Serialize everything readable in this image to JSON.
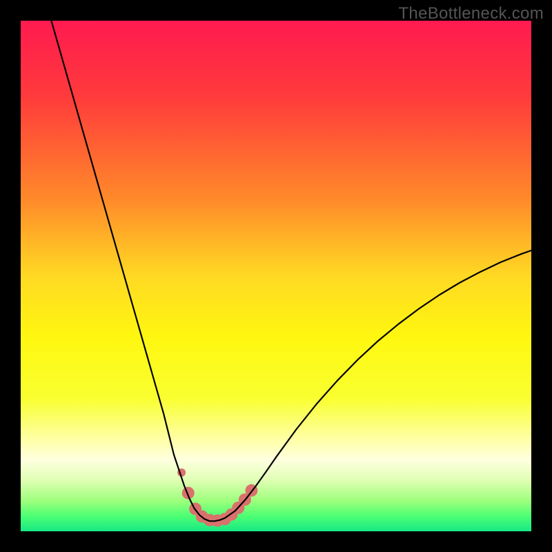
{
  "watermark": "TheBottleneck.com",
  "chart_data": {
    "type": "line",
    "title": "",
    "xlabel": "",
    "ylabel": "",
    "xlim": [
      0,
      100
    ],
    "ylim": [
      0,
      100
    ],
    "background_gradient": {
      "stops": [
        {
          "offset": 0.0,
          "color": "#ff1a50"
        },
        {
          "offset": 0.15,
          "color": "#ff3b3b"
        },
        {
          "offset": 0.35,
          "color": "#ff8a2a"
        },
        {
          "offset": 0.5,
          "color": "#ffd923"
        },
        {
          "offset": 0.62,
          "color": "#fff710"
        },
        {
          "offset": 0.74,
          "color": "#f9ff30"
        },
        {
          "offset": 0.82,
          "color": "#ffffa6"
        },
        {
          "offset": 0.86,
          "color": "#ffffe0"
        },
        {
          "offset": 0.9,
          "color": "#dfffb3"
        },
        {
          "offset": 0.94,
          "color": "#9eff7d"
        },
        {
          "offset": 0.97,
          "color": "#4dff73"
        },
        {
          "offset": 1.0,
          "color": "#17e884"
        }
      ]
    },
    "series": [
      {
        "name": "bottleneck-curve",
        "stroke": "#000000",
        "stroke_width": 2.2,
        "x": [
          6,
          8,
          10,
          12,
          14,
          16,
          18,
          20,
          22,
          24,
          26,
          28,
          30,
          31,
          32,
          33,
          34,
          35,
          36,
          37,
          38,
          39,
          40,
          42,
          44,
          46,
          48,
          50,
          54,
          58,
          62,
          66,
          70,
          74,
          78,
          82,
          86,
          90,
          94,
          98,
          100
        ],
        "y": [
          100,
          93,
          86,
          79,
          72,
          65,
          58,
          51,
          44,
          37,
          30,
          23,
          15,
          12,
          9,
          6.5,
          4.5,
          3.2,
          2.4,
          2.0,
          2.0,
          2.2,
          2.6,
          4.0,
          6.2,
          8.8,
          11.6,
          14.5,
          20.0,
          25.0,
          29.5,
          33.6,
          37.3,
          40.6,
          43.6,
          46.3,
          48.7,
          50.8,
          52.7,
          54.3,
          55.0
        ]
      }
    ],
    "markers": {
      "name": "optimum-cluster",
      "color": "#d9716c",
      "points": [
        {
          "x": 31.5,
          "y": 11.5,
          "r": 6
        },
        {
          "x": 32.8,
          "y": 7.5,
          "r": 9
        },
        {
          "x": 34.2,
          "y": 4.4,
          "r": 9
        },
        {
          "x": 35.5,
          "y": 2.9,
          "r": 9
        },
        {
          "x": 37.0,
          "y": 2.2,
          "r": 9
        },
        {
          "x": 38.5,
          "y": 2.1,
          "r": 9
        },
        {
          "x": 40.0,
          "y": 2.4,
          "r": 9
        },
        {
          "x": 41.3,
          "y": 3.3,
          "r": 9
        },
        {
          "x": 42.6,
          "y": 4.6,
          "r": 9
        },
        {
          "x": 43.9,
          "y": 6.2,
          "r": 9
        },
        {
          "x": 45.2,
          "y": 8.0,
          "r": 9
        }
      ]
    }
  }
}
